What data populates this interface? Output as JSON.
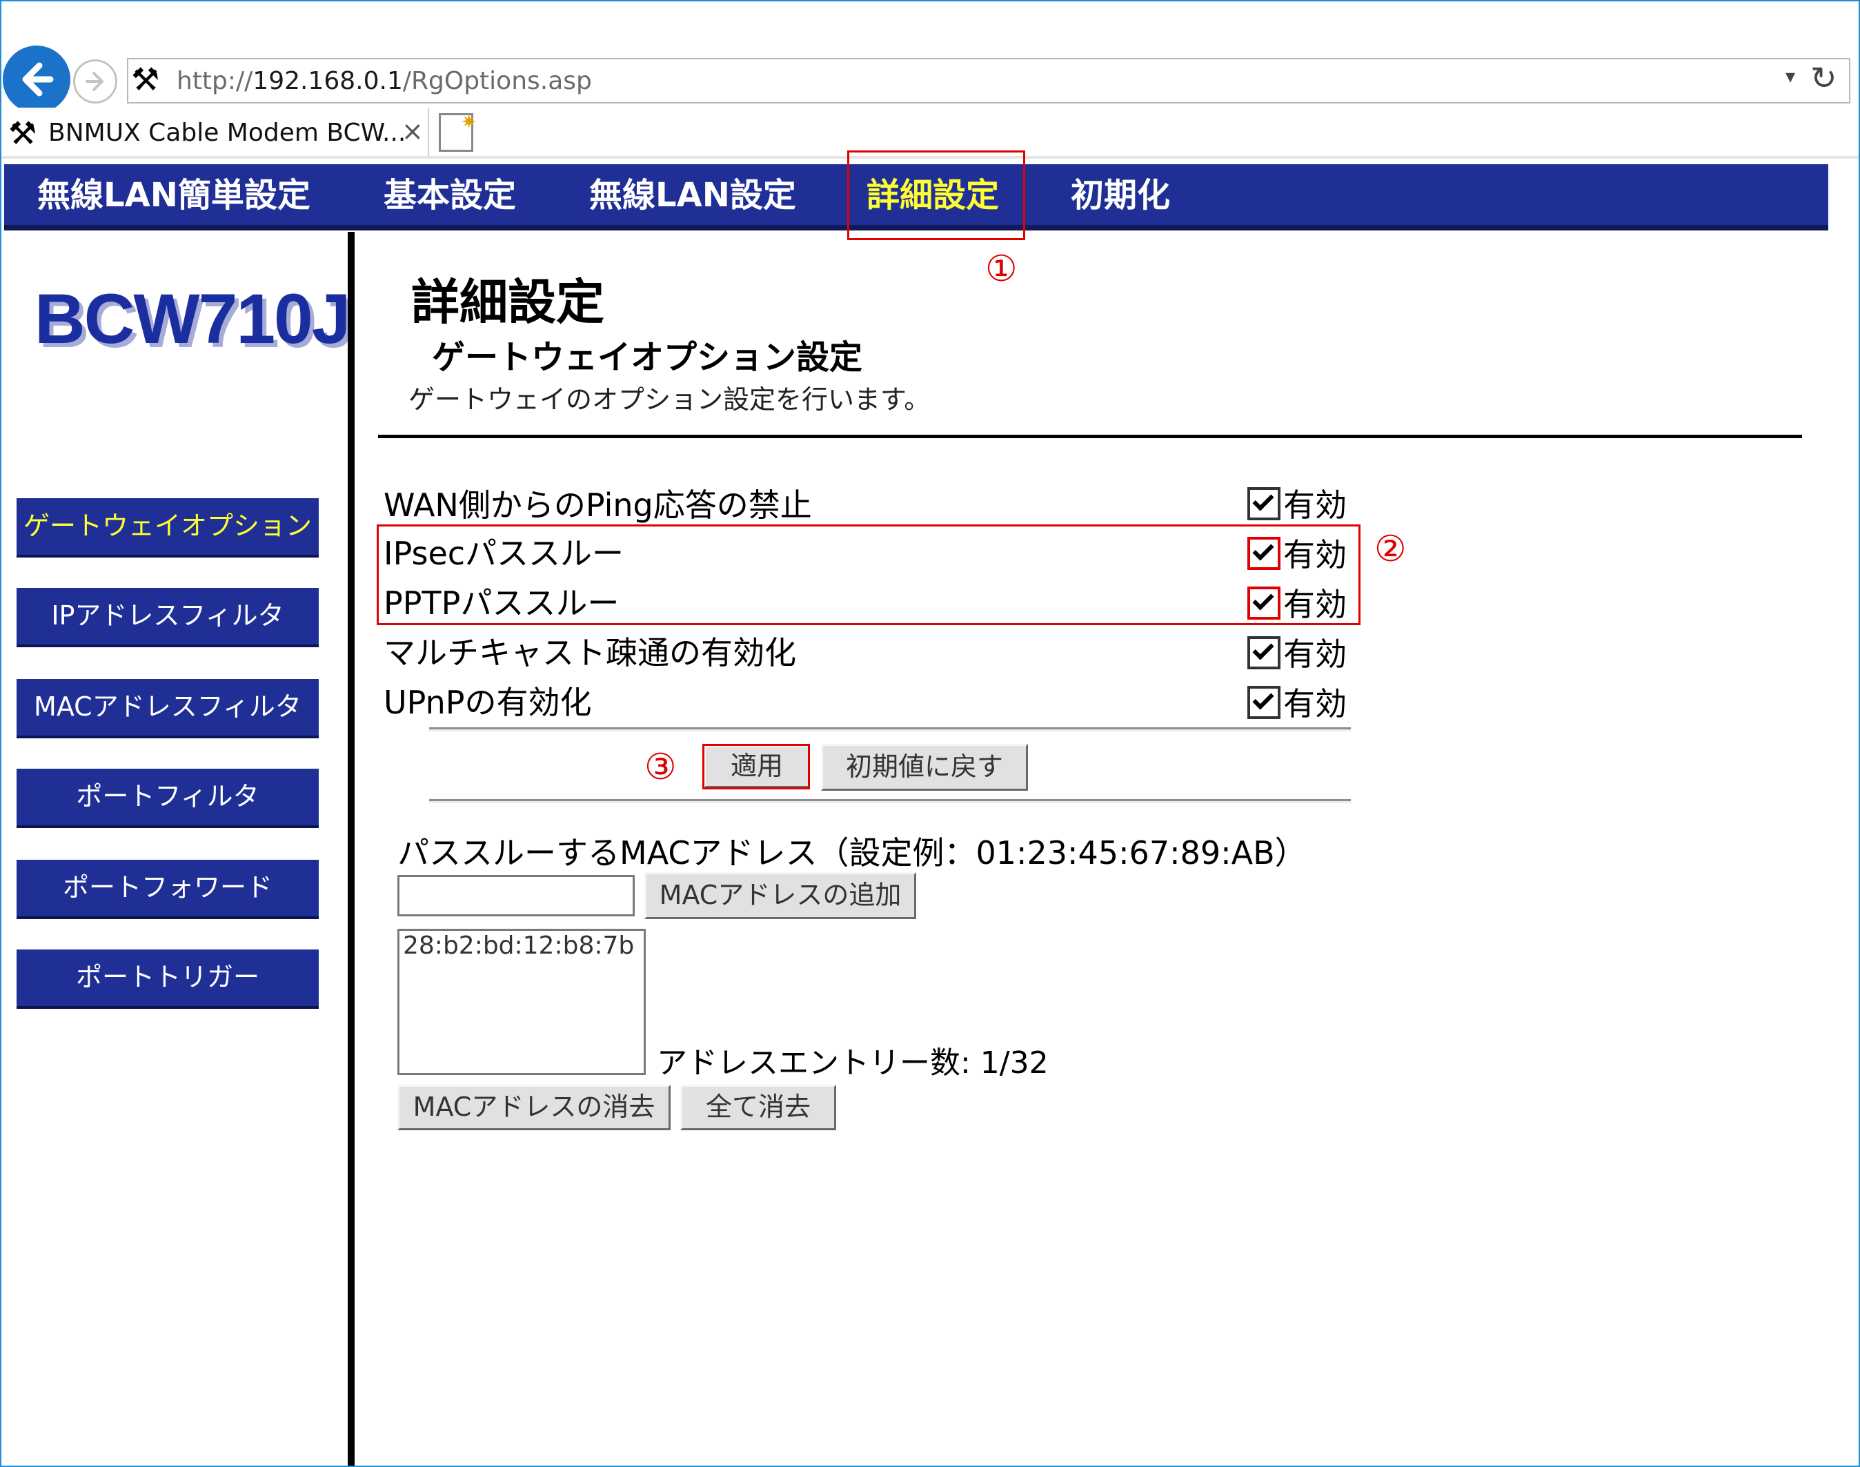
{
  "browser": {
    "url_prefix": "http://",
    "url_host": "192.168.0.1",
    "url_path": "/RgOptions.asp",
    "tab_title": "BNMUX Cable Modem BCW...",
    "tab_close": "×",
    "dropdown_glyph": "▾",
    "refresh_glyph": "↻"
  },
  "topnav": {
    "items": [
      "無線LAN簡単設定",
      "基本設定",
      "無線LAN設定",
      "詳細設定",
      "初期化"
    ],
    "active_index": 3
  },
  "logo": {
    "text": "BCW710J"
  },
  "sidebar": {
    "items": [
      "ゲートウェイオプション",
      "IPアドレスフィルタ",
      "MACアドレスフィルタ",
      "ポートフィルタ",
      "ポートフォワード",
      "ポートトリガー"
    ],
    "active_index": 0
  },
  "main": {
    "page_title": "詳細設定",
    "section_title": "ゲートウェイオプション設定",
    "section_desc": "ゲートウェイのオプション設定を行います。",
    "options": [
      {
        "label": "WAN側からのPing応答の禁止",
        "state": "有効",
        "checked": true
      },
      {
        "label": "IPsecパススルー",
        "state": "有効",
        "checked": true
      },
      {
        "label": "PPTPパススルー",
        "state": "有効",
        "checked": true
      },
      {
        "label": "マルチキャスト疎通の有効化",
        "state": "有効",
        "checked": true
      },
      {
        "label": "UPnPの有効化",
        "state": "有効",
        "checked": true
      }
    ],
    "apply_label": "適用",
    "reset_label": "初期値に戻す",
    "mac": {
      "heading": "パススルーするMACアドレス（設定例：01:23:45:67:89:AB）",
      "input_value": "",
      "add_label": "MACアドレスの追加",
      "entries": [
        "28:b2:bd:12:b8:7b"
      ],
      "entry_count": "アドレスエントリー数: 1/32",
      "delete_label": "MACアドレスの消去",
      "clear_all_label": "全て消去"
    }
  },
  "annotations": {
    "num1": "①",
    "num2": "②",
    "num3": "③",
    "color": "#e00000"
  }
}
